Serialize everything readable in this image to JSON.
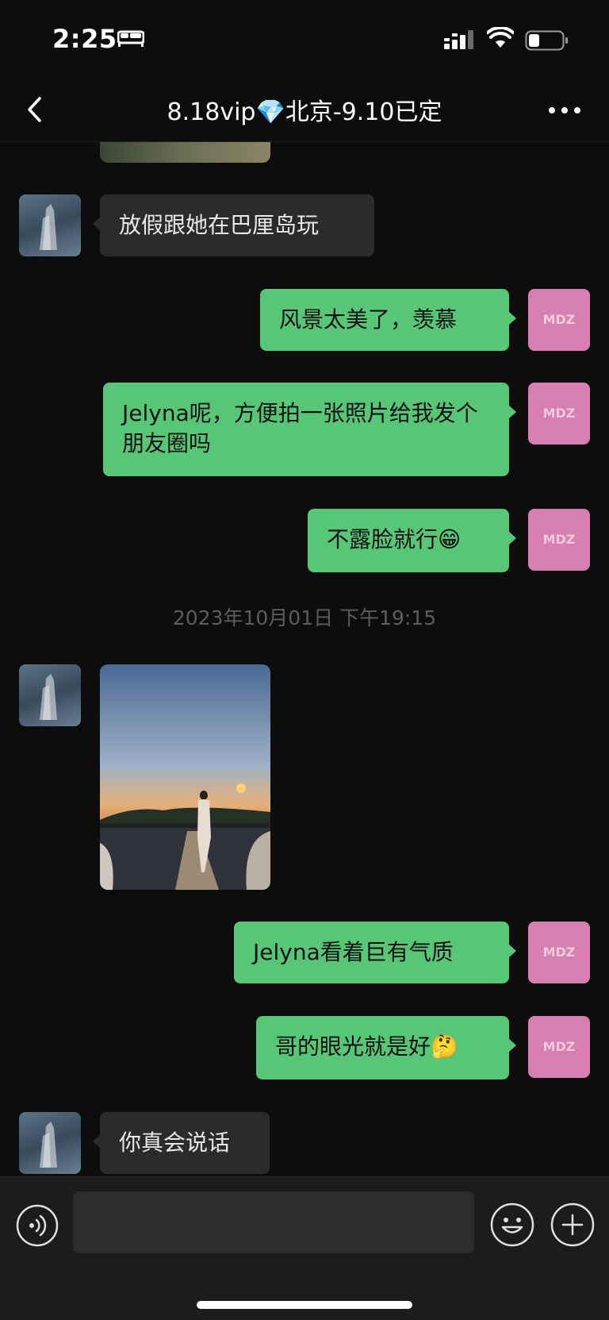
{
  "status_bar": {
    "time": "2:25"
  },
  "header": {
    "title": "8.18vip💎北京-9.10已定"
  },
  "messages": [
    {
      "from": "them",
      "text": "放假跟她在巴厘岛玩"
    },
    {
      "from": "me",
      "text": "风景太美了，羡慕"
    },
    {
      "from": "me",
      "text": "Jelyna呢，方便拍一张照片给我发个朋友圈吗"
    },
    {
      "from": "me",
      "text": "不露脸就行😁"
    },
    {
      "from": "me",
      "text": "Jelyna看着巨有气质"
    },
    {
      "from": "me",
      "text": "哥的眼光就是好🤔"
    },
    {
      "from": "them",
      "text": "你真会说话"
    }
  ],
  "timestamp": "2023年10月01日 下午19:15",
  "input": {
    "value": ""
  },
  "colors": {
    "sent_bubble": "#58c677",
    "received_bubble": "#2b2b2b",
    "background": "#0d0d0d"
  }
}
